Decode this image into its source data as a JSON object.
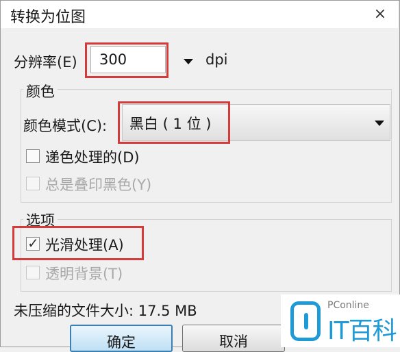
{
  "window": {
    "title": "转换为位图",
    "close": "×"
  },
  "resolution": {
    "label": "分辨率(E)",
    "value": "300",
    "unit": "dpi"
  },
  "color_group": {
    "title": "颜色",
    "mode_label": "颜色模式(C):",
    "mode_value": "黑白 ( 1 位 )",
    "dither": {
      "label": "递色处理的(D)",
      "checked": false,
      "enabled": true
    },
    "overprint": {
      "label": "总是叠印黑色(Y)",
      "checked": false,
      "enabled": false
    }
  },
  "options_group": {
    "title": "选项",
    "smooth": {
      "label": "光滑处理(A)",
      "checked": true,
      "check_glyph": "✓",
      "enabled": true
    },
    "transparent": {
      "label": "透明背景(T)",
      "checked": false,
      "enabled": false
    }
  },
  "size_info": "未压缩的文件大小: 17.5 MB",
  "buttons": {
    "ok": "确定",
    "cancel": "取消"
  },
  "watermark": {
    "top": "PConline",
    "main": "IT百科"
  },
  "colors": {
    "highlight": "#d43c3c",
    "accent": "#1e9ad6"
  }
}
